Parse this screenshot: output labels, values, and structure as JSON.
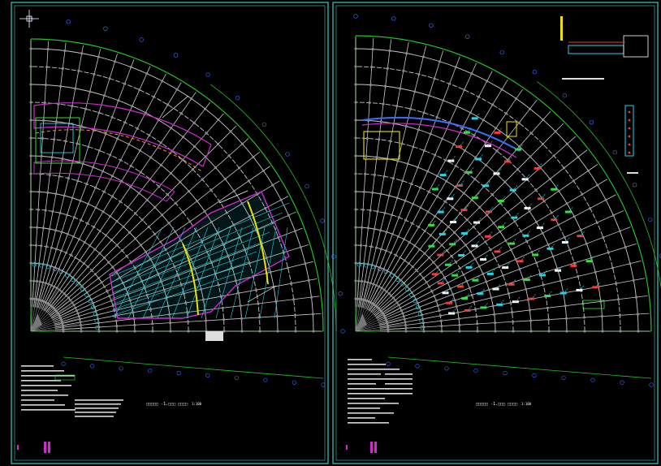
{
  "drawing": {
    "background": "#000000",
    "frame_color": "#2fd3c4",
    "grid_color": "#c8c8c8",
    "arc_color": "#21c421",
    "colors": {
      "magenta": "#d12ad1",
      "cyan": "#1fd6e6",
      "yellow": "#f0e000",
      "white": "#ffffff",
      "green": "#35e035",
      "red": "#ff3030",
      "blue": "#3b6dff"
    }
  },
  "sheets": [
    {
      "name": "left-sheet",
      "title_block": "□□□□□ -1.□□□ □□□□",
      "scale": "1:100"
    },
    {
      "name": "right-sheet",
      "title_block": "□□□□□ -1.□□□ □□□□",
      "scale": "1:100"
    }
  ]
}
